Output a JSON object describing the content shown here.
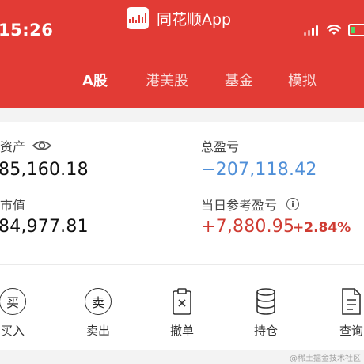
{
  "status_bar": {
    "time": "15:26"
  },
  "app": {
    "title": "同花顺App"
  },
  "tabs": [
    {
      "label": "A股"
    },
    {
      "label": "港美股"
    },
    {
      "label": "基金"
    },
    {
      "label": "模拟"
    }
  ],
  "assets": {
    "total_assets_label": "总资产",
    "total_assets_value": "85,160.18",
    "total_pl_label": "总盈亏",
    "total_pl_value": "−207,118.42",
    "market_value_label": "总市值",
    "market_value_value": "84,977.81",
    "daily_pl_label": "当日参考盈亏",
    "daily_pl_value": "+7,880.95",
    "daily_pl_pct": "+2.84%"
  },
  "actions": [
    {
      "label": "买入",
      "glyph": "买"
    },
    {
      "label": "卖出",
      "glyph": "卖"
    },
    {
      "label": "撤单"
    },
    {
      "label": "持仓"
    },
    {
      "label": "查询"
    }
  ],
  "footer": {
    "watermark": "@稀土掘金技术社区"
  },
  "colors": {
    "header": "#e23b35",
    "loss_blue": "#4f8fd8",
    "gain_red": "#cf3b32"
  }
}
